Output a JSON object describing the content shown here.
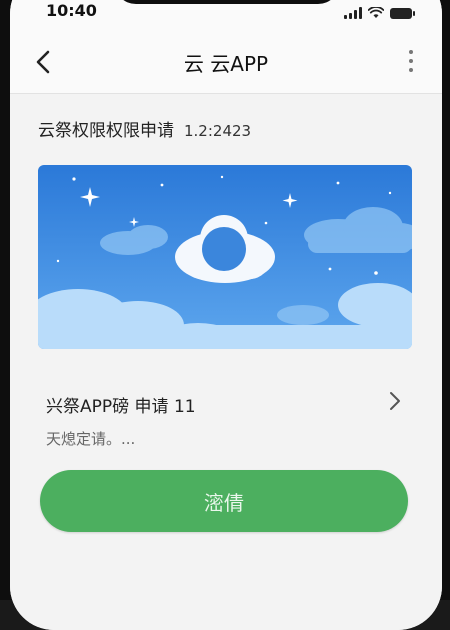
{
  "status_bar": {
    "time": "10:40",
    "icons": [
      "signal-icon",
      "wifi-icon",
      "battery-icon"
    ]
  },
  "nav": {
    "back_icon": "chevron-left-icon",
    "title": "云 云APP",
    "more_icon": "more-vertical-icon"
  },
  "section": {
    "title": "云祭权限权限申请",
    "version": "1.2:2423"
  },
  "banner": {
    "description": "cloud-illustration",
    "colors": {
      "sky_top": "#2b79d8",
      "sky_bottom": "#5ea7ee",
      "cloud": "#f4f8fd"
    }
  },
  "item": {
    "title": "兴祭APP磅 申请 11",
    "description": "天熄定请。...",
    "chevron_icon": "chevron-right-icon"
  },
  "action": {
    "label": "滵倩",
    "color": "#4caf5f"
  }
}
